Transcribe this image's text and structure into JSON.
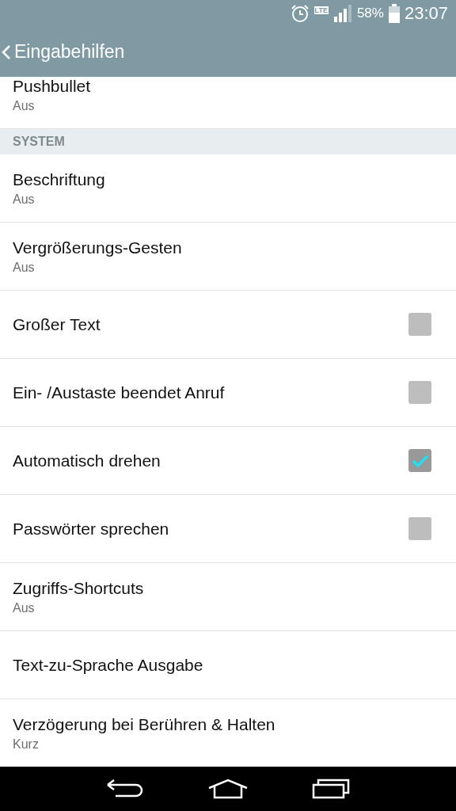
{
  "status_bar": {
    "battery_percent": "58%",
    "time": "23:07",
    "network": "LTE"
  },
  "app_bar": {
    "title": "Eingabehilfen"
  },
  "items": [
    {
      "kind": "summary",
      "title": "Pushbullet",
      "summary": "Aus"
    },
    {
      "kind": "header",
      "title": "SYSTEM"
    },
    {
      "kind": "summary",
      "title": "Beschriftung",
      "summary": "Aus"
    },
    {
      "kind": "summary",
      "title": "Vergrößerungs-Gesten",
      "summary": "Aus"
    },
    {
      "kind": "checkbox",
      "title": "Großer Text",
      "checked": false
    },
    {
      "kind": "checkbox",
      "title": "Ein- /Austaste beendet Anruf",
      "checked": false
    },
    {
      "kind": "checkbox",
      "title": "Automatisch drehen",
      "checked": true
    },
    {
      "kind": "checkbox",
      "title": "Passwörter sprechen",
      "checked": false
    },
    {
      "kind": "summary",
      "title": "Zugriffs-Shortcuts",
      "summary": "Aus"
    },
    {
      "kind": "plain",
      "title": "Text-zu-Sprache Ausgabe"
    },
    {
      "kind": "summary",
      "title": "Verzögerung bei Berühren & Halten",
      "summary": "Kurz"
    }
  ]
}
